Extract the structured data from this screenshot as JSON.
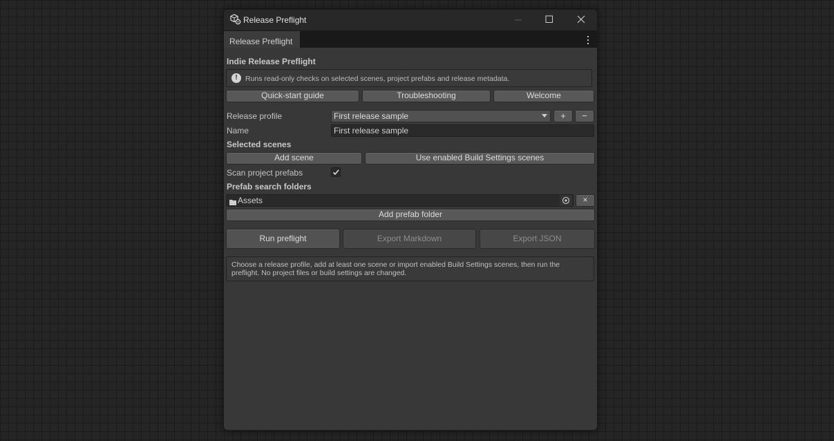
{
  "window": {
    "title": "Release Preflight",
    "app_icon": "unity-cube-gear-icon",
    "controls": [
      "minimize-icon",
      "maximize-icon",
      "close-icon"
    ]
  },
  "tab": {
    "label": "Release Preflight",
    "menu_icon": "kebab-menu-icon"
  },
  "header": {
    "title": "Indie Release Preflight",
    "help_text": "Runs read-only checks on selected scenes, project prefabs and release metadata.",
    "help_icon": "info-icon"
  },
  "links": {
    "quick_start": "Quick-start guide",
    "troubleshooting": "Troubleshooting",
    "welcome": "Welcome"
  },
  "profile": {
    "label": "Release profile",
    "selected": "First release sample",
    "add_label": "+",
    "remove_label": "−"
  },
  "name": {
    "label": "Name",
    "value": "First release sample"
  },
  "scenes": {
    "title": "Selected scenes",
    "add_scene": "Add scene",
    "use_build": "Use enabled Build Settings scenes"
  },
  "prefabs": {
    "scan_label": "Scan project prefabs",
    "scan_checked": true,
    "folders_title": "Prefab search folders",
    "folders": [
      {
        "name": "Assets",
        "icon": "folder-icon"
      }
    ],
    "remove_label": "×",
    "add_folder": "Add prefab folder"
  },
  "actions": {
    "run": "Run preflight",
    "export_md": "Export Markdown",
    "export_json": "Export JSON"
  },
  "status": {
    "message": "Choose a release profile, add at least one scene or import enabled Build Settings scenes, then run the preflight. No project files or build settings are changed."
  },
  "colors": {
    "background": "#252525",
    "window": "#383838",
    "button": "#585858",
    "field": "#2a2a2a"
  }
}
